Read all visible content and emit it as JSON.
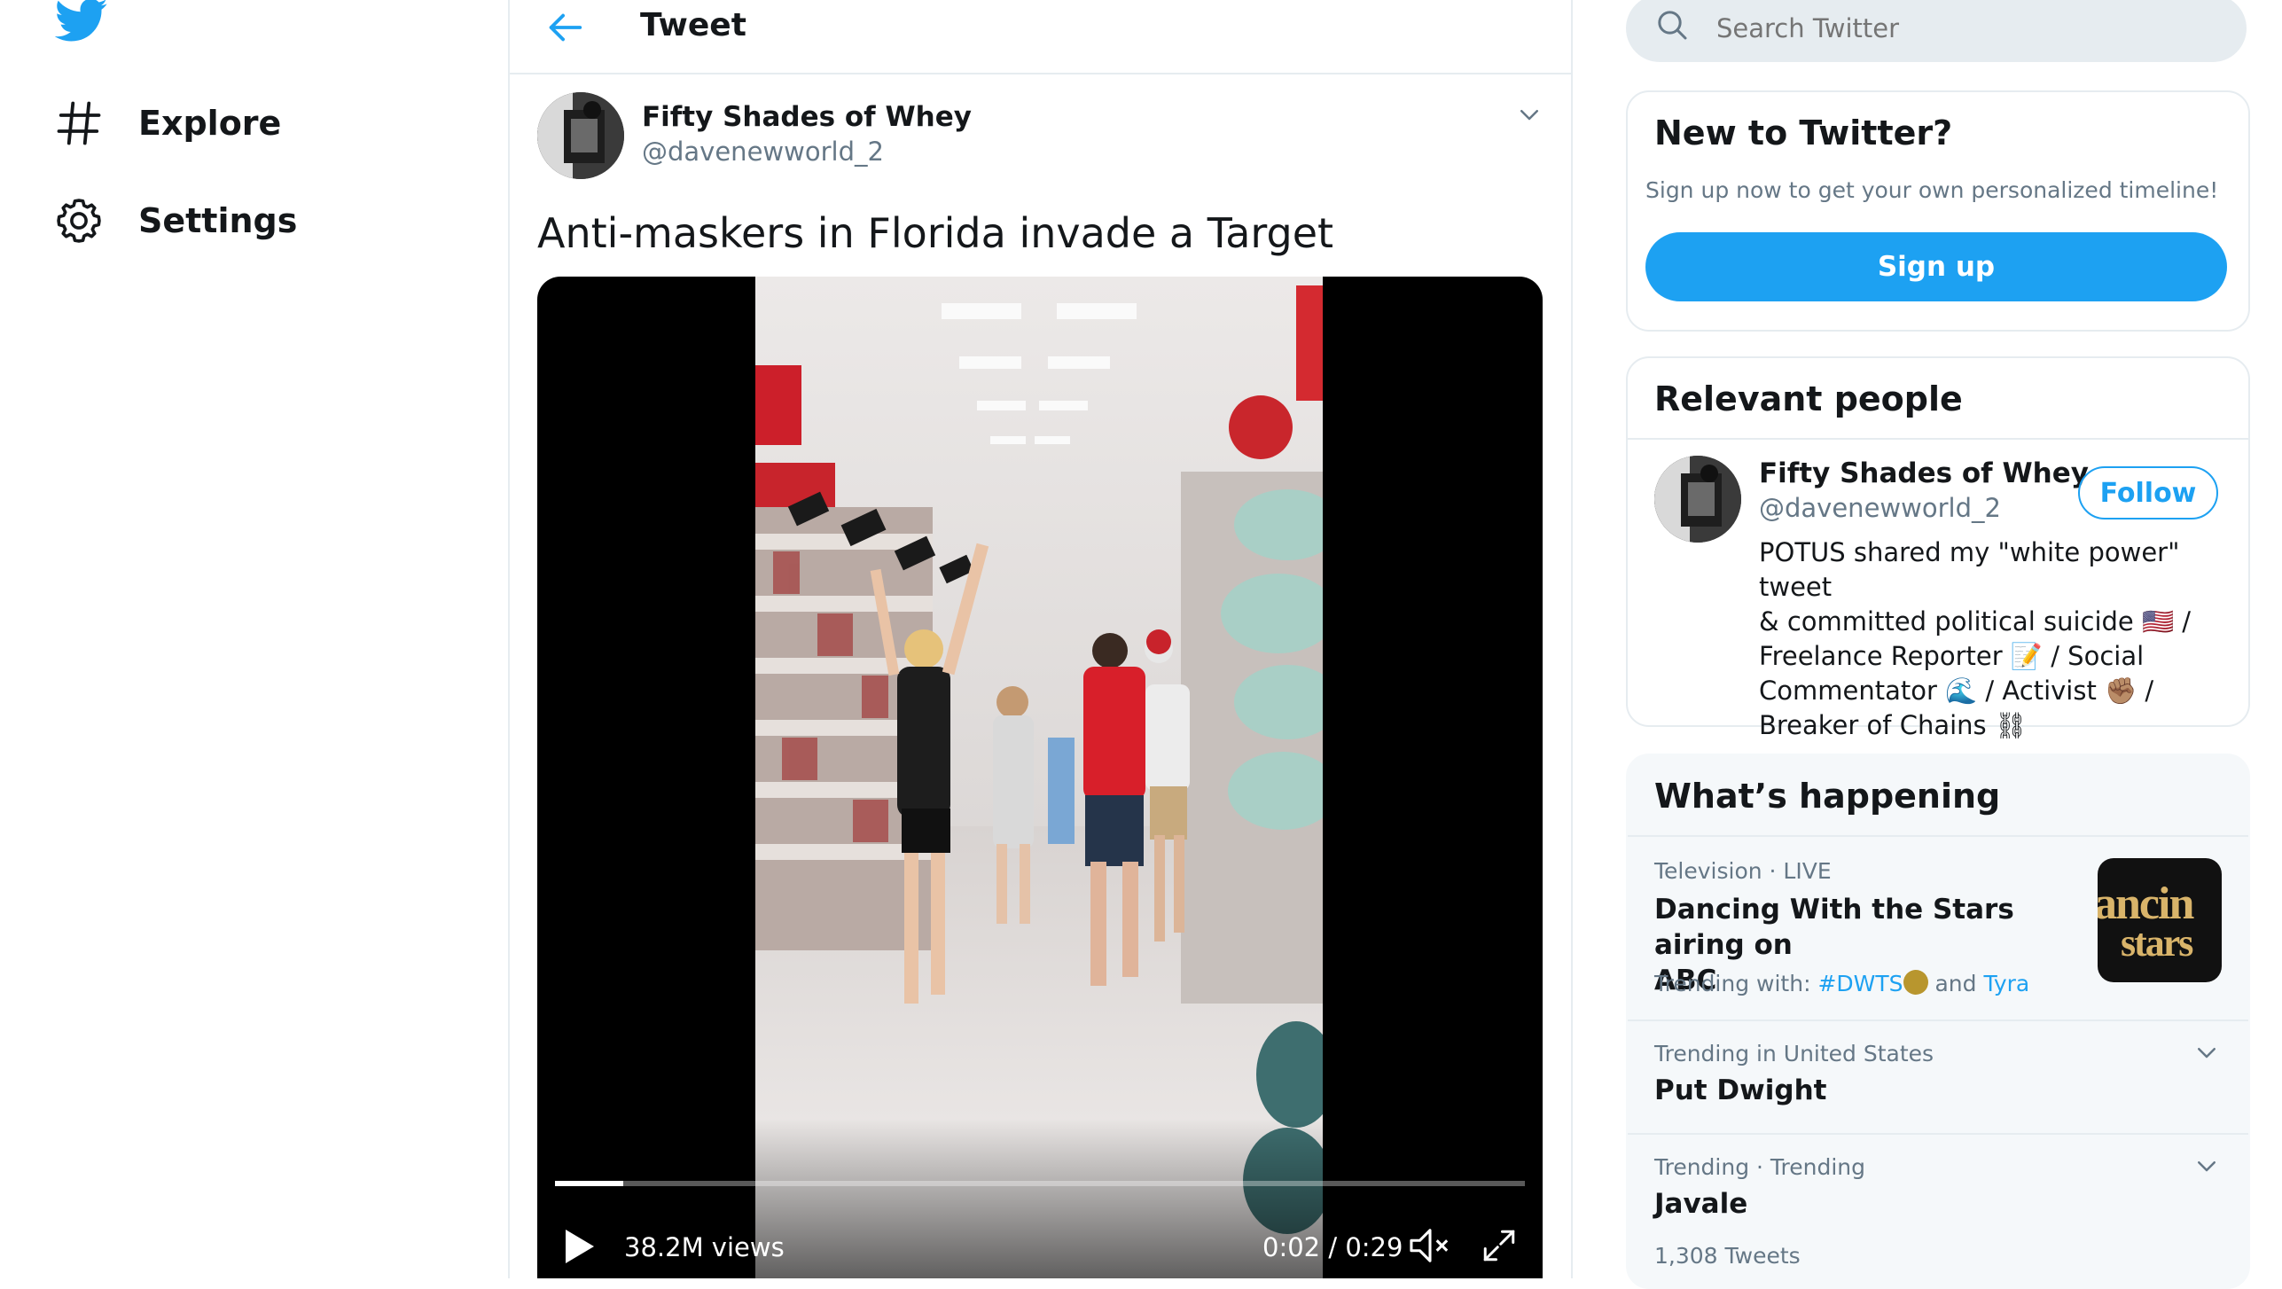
{
  "nav": {
    "logo_icon": "twitter-bird-icon",
    "items": [
      {
        "label": "Explore",
        "icon": "hashtag-icon"
      },
      {
        "label": "Settings",
        "icon": "gear-icon"
      }
    ]
  },
  "header": {
    "back_icon": "back-arrow-icon",
    "title": "Tweet"
  },
  "tweet": {
    "author_name": "Fifty Shades of Whey",
    "author_handle": "@davenewworld_2",
    "text": "Anti-maskers in Florida invade a Target",
    "menu_icon": "chevron-down-icon",
    "video": {
      "views": "38.2M views",
      "time": "0:02 / 0:29",
      "progress": 0.07,
      "icons": [
        "play-icon",
        "mute-icon",
        "fullscreen-icon"
      ]
    }
  },
  "search": {
    "placeholder": "Search Twitter",
    "icon": "search-icon"
  },
  "signup_card": {
    "title": "New to Twitter?",
    "subtitle": "Sign up now to get your own personalized timeline!",
    "button": "Sign up"
  },
  "people_card": {
    "title": "Relevant people",
    "person": {
      "name": "Fifty Shades of Whey",
      "handle": "@davenewworld_2",
      "follow_label": "Follow",
      "bio_lines": [
        "POTUS shared my \"white power\" tweet",
        "& committed political suicide 🇺🇸 /",
        "Freelance Reporter 📝 / Social",
        "Commentator 🌊 / Activist ✊🏽 /",
        "Breaker of Chains ⛓"
      ]
    }
  },
  "trends_card": {
    "title": "What’s happening",
    "items": [
      {
        "meta": "Television · LIVE",
        "title_line1": "Dancing With the Stars airing on",
        "title_line2": "ABC",
        "trending_with_label": "Trending with:",
        "tag1": "#DWTS",
        "and": "and",
        "tag2": "Tyra",
        "thumb_text_1": "ancin",
        "thumb_text_2": "stars"
      },
      {
        "meta": "Trending in United States",
        "title": "Put Dwight"
      },
      {
        "meta": "Trending · Trending",
        "title": "Javale",
        "count": "1,308 Tweets"
      }
    ]
  },
  "colors": {
    "accent": "#1da1f2",
    "text": "#14171a",
    "muted": "#657786",
    "border": "#e6ecf0"
  }
}
